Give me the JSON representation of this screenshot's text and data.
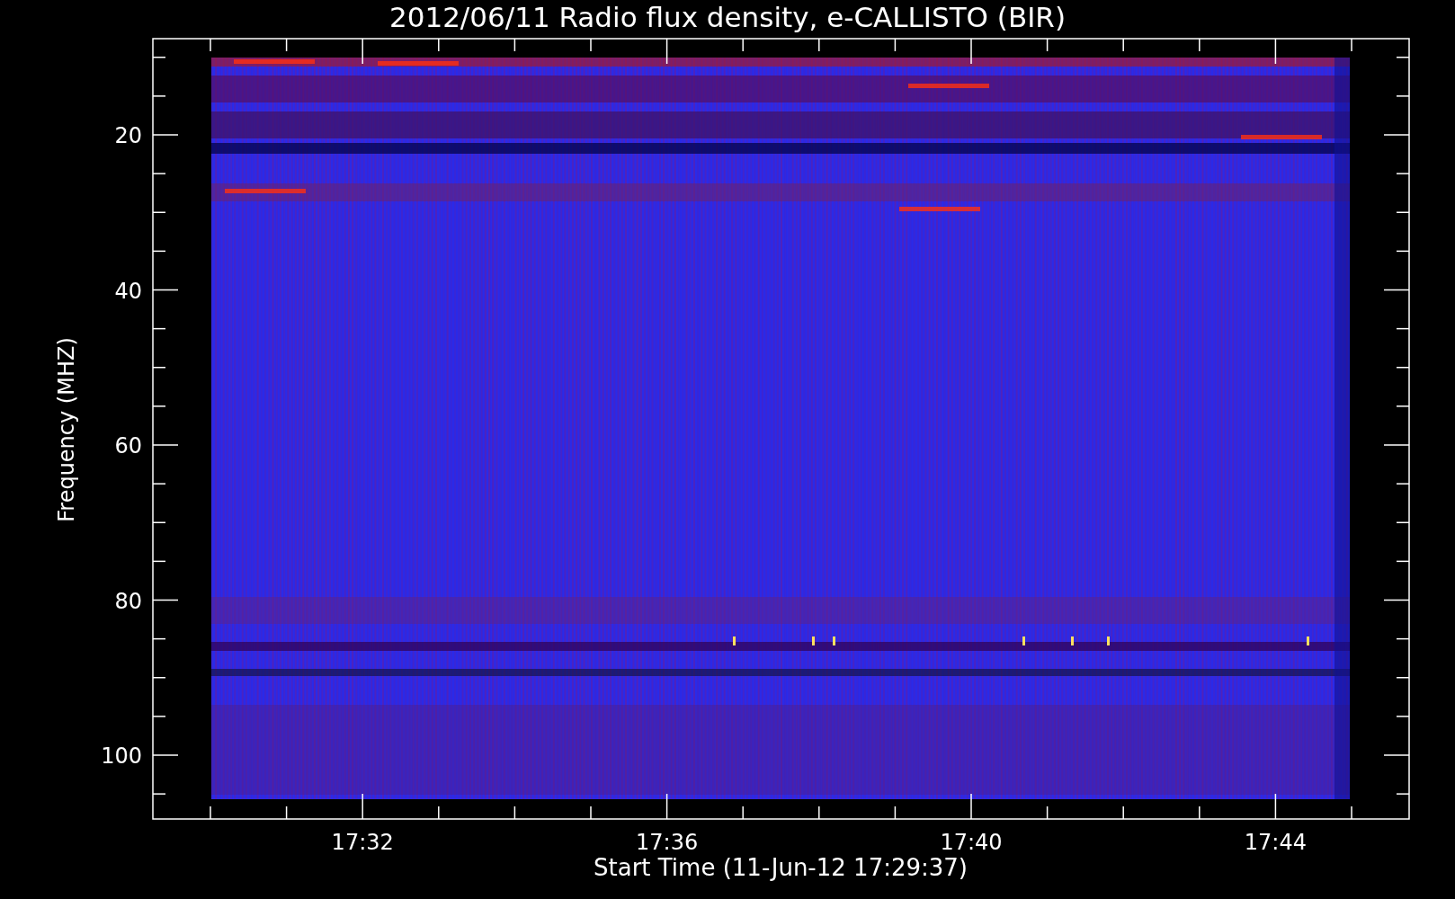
{
  "title": "2012/06/11  Radio flux density, e-CALLISTO (BIR)",
  "y_axis": {
    "label": "Frequency (MHZ)",
    "ticks": [
      "20",
      "40",
      "60",
      "80",
      "100"
    ]
  },
  "x_axis": {
    "label": "Start Time (11-Jun-12 17:29:37)",
    "ticks": [
      "17:32",
      "17:36",
      "17:40",
      "17:44"
    ]
  }
}
